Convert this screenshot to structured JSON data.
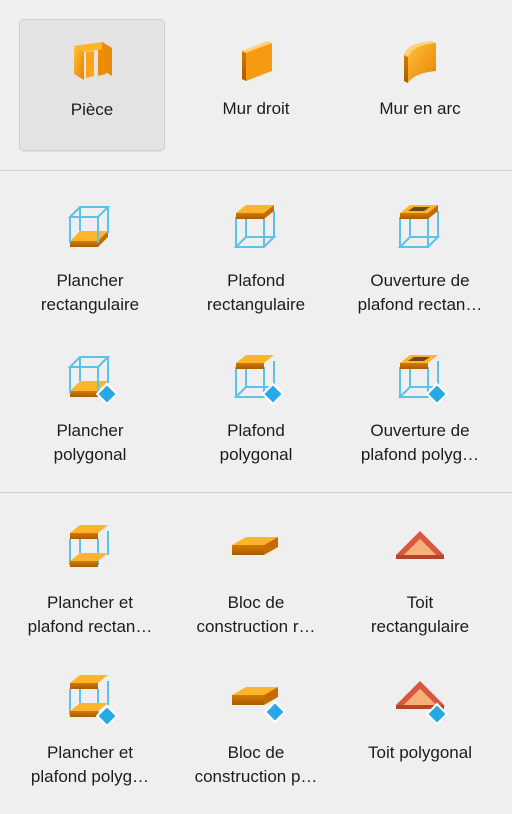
{
  "sections": [
    {
      "items": [
        {
          "label": "Pièce",
          "icon": "room-icon",
          "selected": true
        },
        {
          "label": "Mur droit",
          "icon": "straight-wall-icon"
        },
        {
          "label": "Mur en arc",
          "icon": "arc-wall-icon"
        }
      ]
    },
    {
      "items": [
        {
          "label": "Plancher\nrectangulaire",
          "icon": "rectangular-floor-icon"
        },
        {
          "label": "Plafond\nrectangulaire",
          "icon": "rectangular-ceiling-icon"
        },
        {
          "label": "Ouverture de\nplafond rectan…",
          "icon": "rectangular-ceiling-opening-icon"
        },
        {
          "label": "Plancher\npolygonal",
          "icon": "polygonal-floor-icon"
        },
        {
          "label": "Plafond\npolygonal",
          "icon": "polygonal-ceiling-icon"
        },
        {
          "label": "Ouverture de\nplafond polyg…",
          "icon": "polygonal-ceiling-opening-icon"
        }
      ]
    },
    {
      "items": [
        {
          "label": "Plancher et\nplafond rectan…",
          "icon": "rectangular-floor-ceiling-icon"
        },
        {
          "label": "Bloc de\nconstruction r…",
          "icon": "rectangular-building-block-icon"
        },
        {
          "label": "Toit\nrectangulaire",
          "icon": "rectangular-roof-icon"
        },
        {
          "label": "Plancher et\nplafond polyg…",
          "icon": "polygonal-floor-ceiling-icon"
        },
        {
          "label": "Bloc de\nconstruction p…",
          "icon": "polygonal-building-block-icon"
        },
        {
          "label": "Toit polygonal",
          "icon": "polygonal-roof-icon"
        }
      ]
    }
  ],
  "colors": {
    "orange": "#f39c12",
    "blue": "#5bc2ea",
    "roof": "#d9573f",
    "background": "#efefef"
  }
}
